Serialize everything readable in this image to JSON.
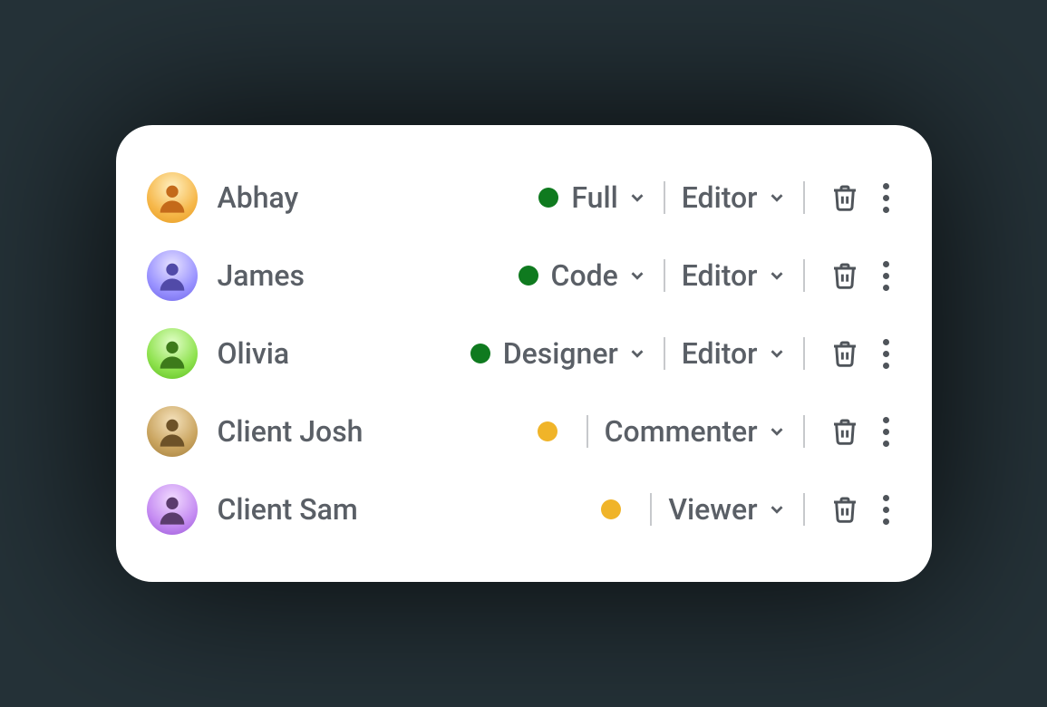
{
  "members": [
    {
      "name": "Abhay",
      "avatar_color": "orange",
      "status_color": "green",
      "role": "Full",
      "permission": "Editor",
      "has_role": true
    },
    {
      "name": "James",
      "avatar_color": "blue",
      "status_color": "green",
      "role": "Code",
      "permission": "Editor",
      "has_role": true
    },
    {
      "name": "Olivia",
      "avatar_color": "green",
      "status_color": "green",
      "role": "Designer",
      "permission": "Editor",
      "has_role": true
    },
    {
      "name": "Client Josh",
      "avatar_color": "gold",
      "status_color": "yellow",
      "role": "",
      "permission": "Commenter",
      "has_role": false
    },
    {
      "name": "Client Sam",
      "avatar_color": "lilac",
      "status_color": "yellow",
      "role": "",
      "permission": "Viewer",
      "has_role": false
    }
  ],
  "colors": {
    "status_green": "#0f7a1f",
    "status_yellow": "#f0b429",
    "text": "#5a5f66",
    "divider": "#c7c9cc"
  }
}
